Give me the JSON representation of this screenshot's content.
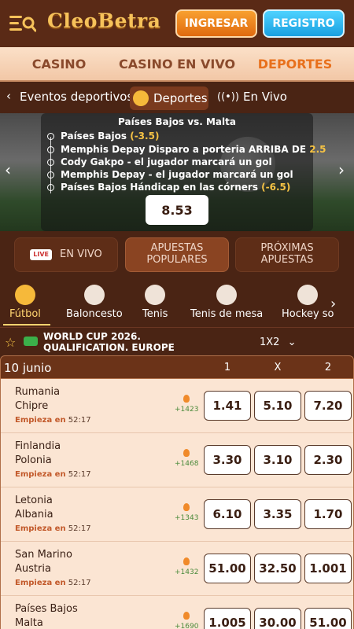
{
  "header": {
    "logo": "CleoBetra",
    "login_label": "INGRESAR",
    "register_label": "REGISTRO"
  },
  "topnav": {
    "items": [
      {
        "label": "CASINO"
      },
      {
        "label": "CASINO EN VIVO"
      },
      {
        "label": "DEPORTES",
        "active": true
      }
    ]
  },
  "subnav": {
    "back_label": "Eventos deportivos",
    "deportes_label": "Deportes",
    "envivo_label": "En Vivo"
  },
  "banner": {
    "title": "Países Bajos   vs.   Malta",
    "legs": [
      {
        "text": "Países Bajos",
        "odd": "(-3.5)"
      },
      {
        "text": "Memphis Depay Disparo a porteria  ARRIBA DE",
        "odd": "2.5"
      },
      {
        "text": "Cody Gakpo - el jugador marcará un gol",
        "odd": ""
      },
      {
        "text": "Memphis Depay - el jugador marcará un gol",
        "odd": ""
      },
      {
        "text": "Países Bajos Hándicap en las córners",
        "odd": "(-6.5)"
      }
    ],
    "total_odds": "8.53"
  },
  "filters": {
    "live_badge": "LIVE",
    "envivo": "EN VIVO",
    "populares": "APUESTAS POPULARES",
    "proximas": "PRÓXIMAS APUESTAS"
  },
  "sports": [
    {
      "label": "Fútbol",
      "icon": "soccer-icon",
      "active": true
    },
    {
      "label": "Baloncesto",
      "icon": "basketball-icon"
    },
    {
      "label": "Tenis",
      "icon": "tennis-icon"
    },
    {
      "label": "Tenis de mesa",
      "icon": "table-tennis-icon"
    },
    {
      "label": "Hockey so",
      "icon": "hockey-icon"
    }
  ],
  "league": {
    "name_line1": "WORLD CUP 2026.",
    "name_line2": "QUALIFICATION. EUROPE",
    "market": "1X2"
  },
  "table": {
    "date": "10 junio",
    "col1": "1",
    "colx": "X",
    "col2": "2",
    "starts_label": "Empieza en",
    "rows": [
      {
        "team1": "Rumania",
        "team2": "Chipre",
        "time": "52:17",
        "count": "+1423",
        "o1": "1.41",
        "ox": "5.10",
        "o2": "7.20"
      },
      {
        "team1": "Finlandia",
        "team2": "Polonia",
        "time": "52:17",
        "count": "+1468",
        "o1": "3.30",
        "ox": "3.10",
        "o2": "2.30"
      },
      {
        "team1": "Letonia",
        "team2": "Albania",
        "time": "52:17",
        "count": "+1343",
        "o1": "6.10",
        "ox": "3.35",
        "o2": "1.70"
      },
      {
        "team1": "San Marino",
        "team2": "Austria",
        "time": "52:17",
        "count": "+1432",
        "o1": "51.00",
        "ox": "32.50",
        "o2": "1.001"
      },
      {
        "team1": "Países Bajos",
        "team2": "Malta",
        "time": "",
        "count": "+1690",
        "o1": "1.005",
        "ox": "30.00",
        "o2": "51.00"
      }
    ]
  }
}
